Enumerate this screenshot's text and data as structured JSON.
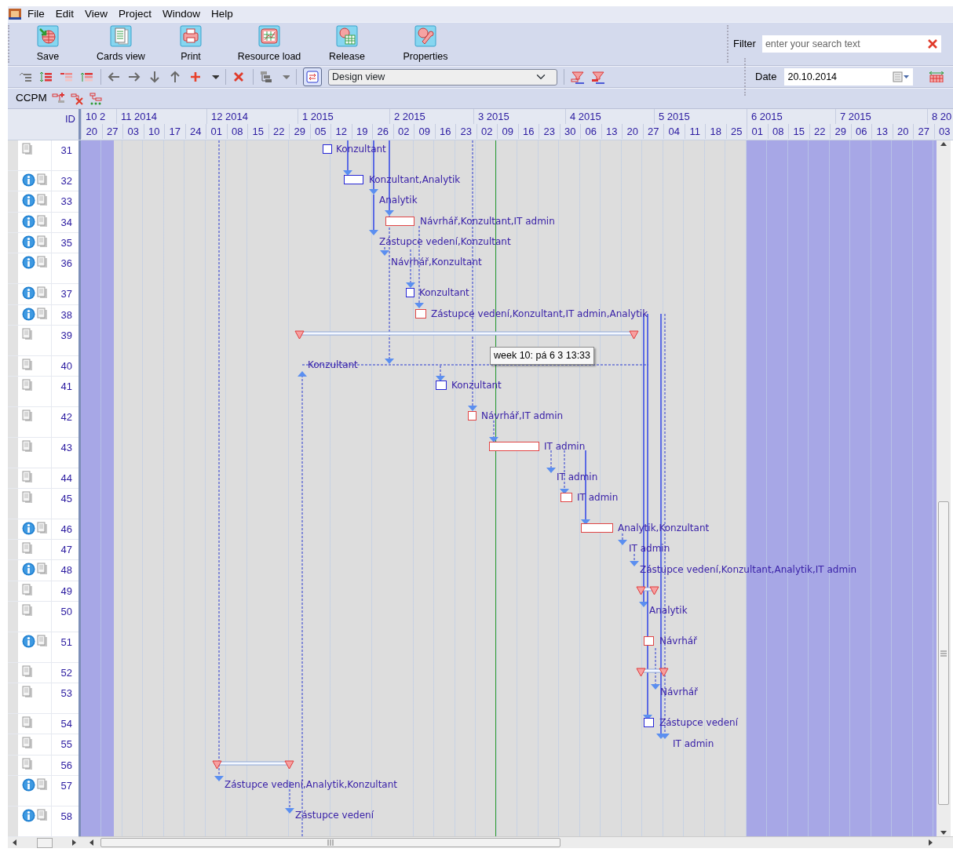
{
  "menu": [
    "File",
    "Edit",
    "View",
    "Project",
    "Window",
    "Help"
  ],
  "toolbar": [
    {
      "label": "Save"
    },
    {
      "label": "Cards view"
    },
    {
      "label": "Print"
    },
    {
      "label": "Resource load"
    },
    {
      "label": "Release"
    },
    {
      "label": "Properties"
    }
  ],
  "filter": {
    "label": "Filter",
    "placeholder": "enter your search text"
  },
  "view_toggle": {
    "pressed": true
  },
  "view_select": {
    "value": "Design view"
  },
  "date": {
    "label": "Date",
    "value": "20.10.2014"
  },
  "ccpm": {
    "label": "CCPM"
  },
  "timeline": {
    "id_header": "ID",
    "months": [
      "10 2",
      "11 2014",
      "12 2014",
      "1 2015",
      "2 2015",
      "3 2015",
      "4 2015",
      "5 2015",
      "6 2015",
      "7 2015",
      "8 20"
    ],
    "weeks": [
      "20",
      "27",
      "03",
      "10",
      "17",
      "24",
      "01",
      "08",
      "15",
      "22",
      "29",
      "05",
      "12",
      "19",
      "26",
      "02",
      "09",
      "16",
      "23",
      "02",
      "09",
      "16",
      "23",
      "30",
      "06",
      "13",
      "20",
      "27",
      "04",
      "11",
      "18",
      "25",
      "01",
      "08",
      "15",
      "22",
      "29",
      "06",
      "13",
      "20",
      "27",
      "03"
    ]
  },
  "tasks": [
    {
      "id": "31",
      "info": false,
      "kind": "bar",
      "critical": false,
      "label": "Konzultant"
    },
    {
      "id": "32",
      "info": true,
      "kind": "bar",
      "critical": false,
      "label": "Konzultant,Analytik"
    },
    {
      "id": "33",
      "info": true,
      "kind": "label",
      "label": "Analytik"
    },
    {
      "id": "34",
      "info": true,
      "kind": "bar",
      "critical": true,
      "label": "Návrhář,Konzultant,IT admin"
    },
    {
      "id": "35",
      "info": true,
      "kind": "label",
      "label": "Zástupce vedení,Konzultant"
    },
    {
      "id": "36",
      "info": true,
      "kind": "label",
      "label": "Návrhář,Konzultant"
    },
    {
      "id": "37",
      "info": true,
      "kind": "bar",
      "critical": false,
      "label": "Konzultant"
    },
    {
      "id": "38",
      "info": true,
      "kind": "bar",
      "critical": true,
      "label": "Zástupce vedení,Konzultant,IT admin,Analytik"
    },
    {
      "id": "39",
      "info": false,
      "kind": "buffer"
    },
    {
      "id": "40",
      "info": false,
      "kind": "label",
      "label": "Konzultant"
    },
    {
      "id": "41",
      "info": false,
      "kind": "bar",
      "critical": false,
      "label": "Konzultant"
    },
    {
      "id": "42",
      "info": false,
      "kind": "bar",
      "critical": true,
      "label": "Návrhář,IT admin"
    },
    {
      "id": "43",
      "info": false,
      "kind": "bar",
      "critical": true,
      "label": "IT admin"
    },
    {
      "id": "44",
      "info": false,
      "kind": "label",
      "label": "IT admin"
    },
    {
      "id": "45",
      "info": false,
      "kind": "bar",
      "critical": true,
      "label": "IT admin"
    },
    {
      "id": "46",
      "info": true,
      "kind": "bar",
      "critical": true,
      "label": "Analytik,Konzultant"
    },
    {
      "id": "47",
      "info": false,
      "kind": "label",
      "label": "IT admin"
    },
    {
      "id": "48",
      "info": true,
      "kind": "label",
      "label": "Zástupce vedení,Konzultant,Analytik,IT admin"
    },
    {
      "id": "49",
      "info": false,
      "kind": "buffer"
    },
    {
      "id": "50",
      "info": false,
      "kind": "label",
      "label": "Analytik"
    },
    {
      "id": "51",
      "info": true,
      "kind": "bar",
      "critical": true,
      "label": "Návrhář"
    },
    {
      "id": "52",
      "info": false,
      "kind": "buffer"
    },
    {
      "id": "53",
      "info": false,
      "kind": "label",
      "label": "Návrhář"
    },
    {
      "id": "54",
      "info": false,
      "kind": "bar",
      "critical": false,
      "label": "Zástupce vedení"
    },
    {
      "id": "55",
      "info": false,
      "kind": "label",
      "label": "IT admin"
    },
    {
      "id": "56",
      "info": false,
      "kind": "buffer"
    },
    {
      "id": "57",
      "info": true,
      "kind": "label",
      "label": "Zástupce vedení,Analytik,Konzultant"
    },
    {
      "id": "58",
      "info": true,
      "kind": "label",
      "label": "Zástupce vedení"
    }
  ],
  "tooltip": "week 10: pá 6 3 13:33"
}
